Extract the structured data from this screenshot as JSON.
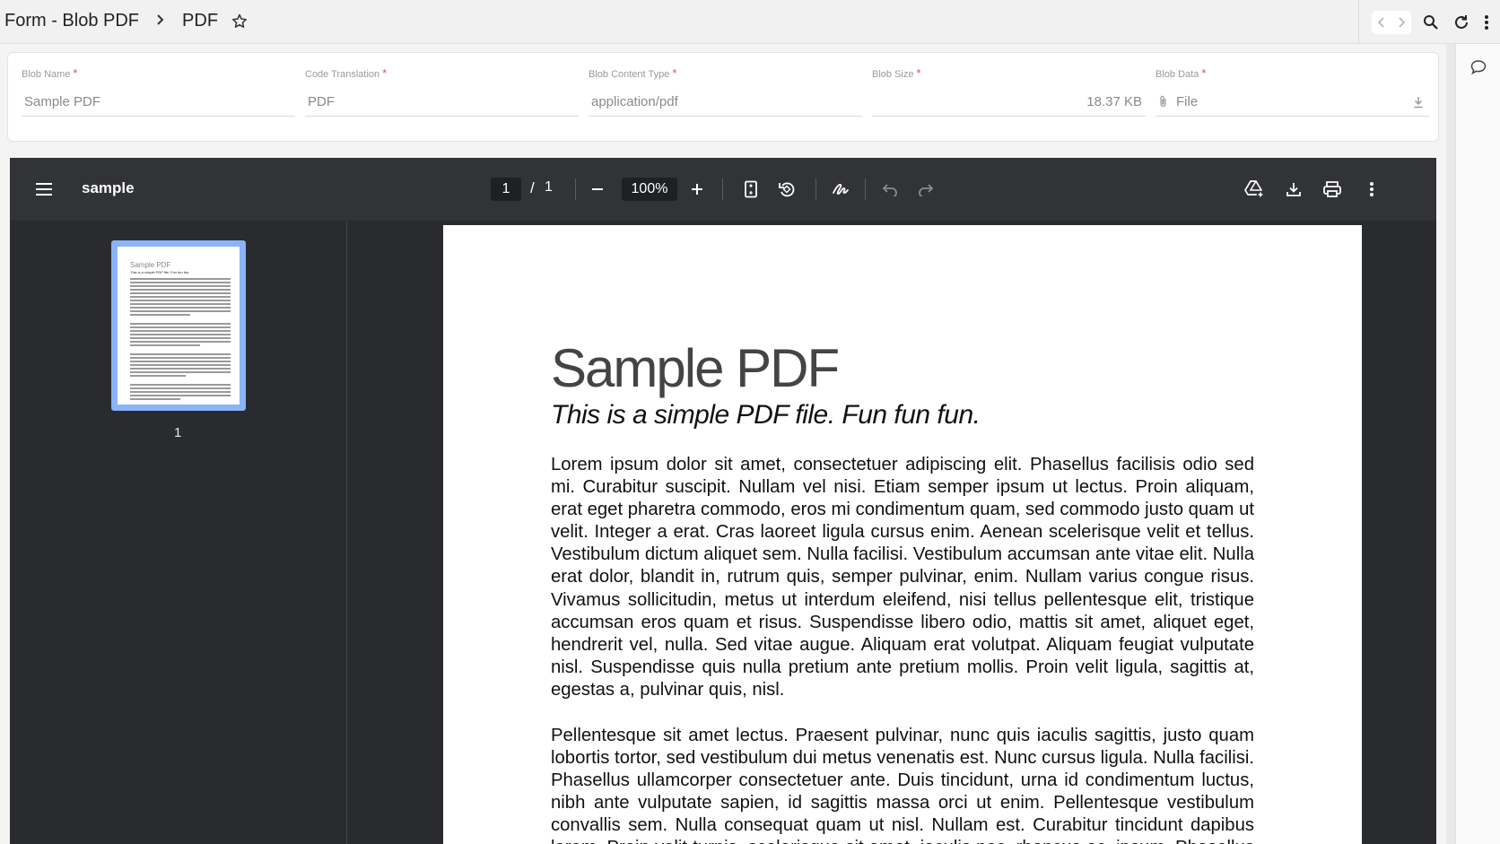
{
  "header": {
    "breadcrumb_root": "Form - Blob PDF",
    "breadcrumb_current": "PDF"
  },
  "form": {
    "fields": [
      {
        "label": "Blob Name",
        "value": "Sample PDF",
        "required": "*"
      },
      {
        "label": "Code Translation",
        "value": "PDF",
        "required": "*"
      },
      {
        "label": "Blob Content Type",
        "value": "application/pdf",
        "required": "*"
      },
      {
        "label": "Blob Size",
        "value": "18.37 KB",
        "required": "*"
      },
      {
        "label": "Blob Data",
        "value": "File",
        "required": "*"
      }
    ]
  },
  "viewer": {
    "title": "sample",
    "current_page": "1",
    "page_sep": "/",
    "total_pages": "1",
    "zoom": "100%",
    "thumb_label": "1"
  },
  "document": {
    "title": "Sample PDF",
    "subtitle": "This is a simple PDF file. Fun fun fun.",
    "paragraph1": "Lorem ipsum dolor sit amet, consectetuer adipiscing elit. Phasellus facilisis odio sed mi. Curabitur suscipit. Nullam vel nisi. Etiam semper ipsum ut lectus. Proin aliquam, erat eget pharetra commodo, eros mi condimentum quam, sed commodo justo quam ut velit. Integer a erat. Cras laoreet ligula cursus enim. Aenean scelerisque velit et tellus. Vestibulum dictum aliquet sem. Nulla facilisi. Vestibulum accumsan ante vitae elit. Nulla erat dolor, blandit in, rutrum quis, semper pulvinar, enim. Nullam varius congue risus. Vivamus sollicitudin, metus ut interdum eleifend, nisi tellus pellentesque elit, tristique accumsan eros quam et risus. Suspendisse libero odio, mattis sit amet, aliquet eget, hendrerit vel, nulla. Sed vitae augue. Aliquam erat volutpat. Aliquam feugiat vulputate nisl. Suspendisse quis nulla pretium ante pretium mollis. Proin velit ligula, sagittis at, egestas a, pulvinar quis, nisl.",
    "paragraph2": "Pellentesque sit amet lectus. Praesent pulvinar, nunc quis iaculis sagittis, justo quam lobortis tortor, sed vestibulum dui metus venenatis est. Nunc cursus ligula. Nulla facilisi. Phasellus ullamcorper consectetuer ante. Duis tincidunt, urna id condimentum luctus, nibh ante vulputate sapien, id sagittis massa orci ut enim. Pellentesque vestibulum convallis sem. Nulla consequat quam ut nisl. Nullam est. Curabitur tincidunt dapibus lorem. Proin velit turpis, scelerisque sit amet, iaculis nec, rhoncus ac, ipsum. Phasellus lorem arcu."
  },
  "icons": [
    "chevron-right-icon",
    "star-icon",
    "back-icon",
    "forward-icon",
    "search-icon",
    "refresh-icon",
    "more-vert-icon",
    "comment-icon",
    "paperclip-icon",
    "download-icon",
    "menu-icon",
    "minus-icon",
    "plus-icon",
    "fit-page-icon",
    "rotate-icon",
    "annotate-icon",
    "undo-icon",
    "redo-icon",
    "drive-add-icon",
    "print-icon"
  ],
  "colors": {
    "thumb_border": "#8ab4f8",
    "required": "#e05353",
    "viewer_bg": "#2a2b2e",
    "viewer_toolbar": "#323337"
  }
}
